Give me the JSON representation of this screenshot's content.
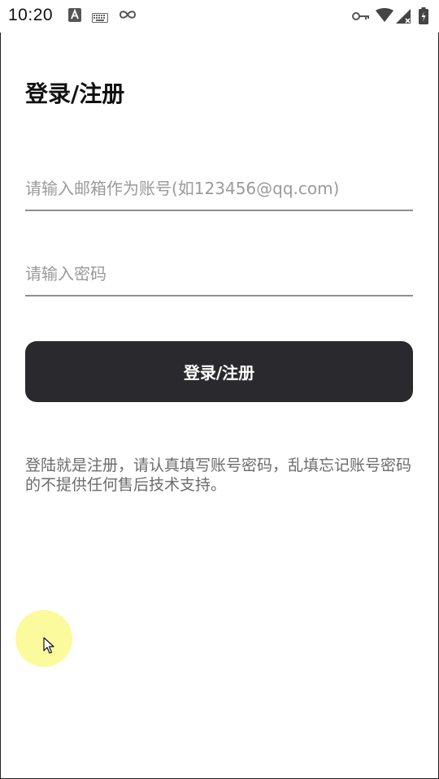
{
  "status_bar": {
    "time": "10:20",
    "left_icons": [
      "a-notification-icon",
      "keyboard-icon",
      "link-icon"
    ],
    "right_icons": [
      "key-icon",
      "wifi-icon",
      "signal-icon",
      "battery-icon"
    ]
  },
  "login": {
    "title": "登录/注册",
    "email_placeholder": "请输入邮箱作为账号(如123456@qq.com)",
    "email_value": "",
    "password_placeholder": "请输入密码",
    "password_value": "",
    "submit_label": "登录/注册",
    "notice": "登陆就是注册，请认真填写账号密码，乱填忘记账号密码的不提供任何售后技术支持。"
  },
  "colors": {
    "button_bg": "#2a2a2e",
    "button_text": "#ffffff",
    "placeholder": "#9a9a9a",
    "notice_text": "#6b6b6b",
    "touch_indicator": "#fafa8c"
  }
}
